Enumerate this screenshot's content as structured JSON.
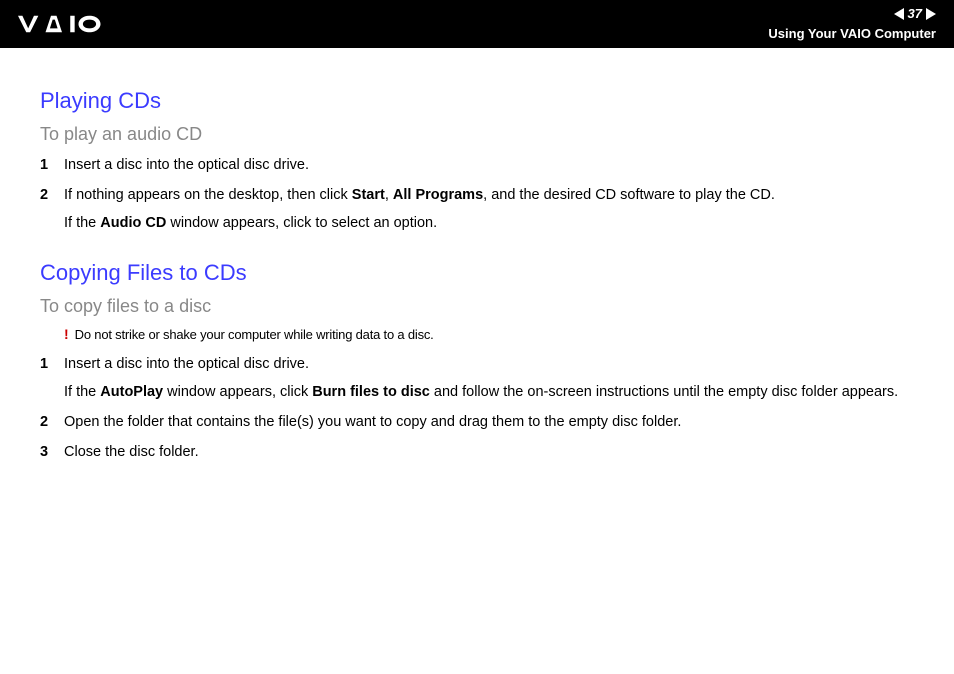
{
  "header": {
    "page_number": "37",
    "section": "Using Your VAIO Computer"
  },
  "section1": {
    "title": "Playing CDs",
    "subtitle": "To play an audio CD",
    "steps": [
      {
        "num": "1",
        "text": "Insert a disc into the optical disc drive."
      },
      {
        "num": "2",
        "html": "If nothing appears on the desktop, then click <b>Start</b>, <b>All Programs</b>, and the desired CD software to play the CD.",
        "sub_html": "If the <b>Audio CD</b> window appears, click to select an option."
      }
    ]
  },
  "section2": {
    "title": "Copying Files to CDs",
    "subtitle": "To copy files to a disc",
    "warning": "Do not strike or shake your computer while writing data to a disc.",
    "steps": [
      {
        "num": "1",
        "text": "Insert a disc into the optical disc drive.",
        "sub_html": "If the <b>AutoPlay</b> window appears, click <b>Burn files to disc</b> and follow the on-screen instructions until the empty disc folder appears."
      },
      {
        "num": "2",
        "text": "Open the folder that contains the file(s) you want to copy and drag them to the empty disc folder."
      },
      {
        "num": "3",
        "text": "Close the disc folder."
      }
    ]
  }
}
